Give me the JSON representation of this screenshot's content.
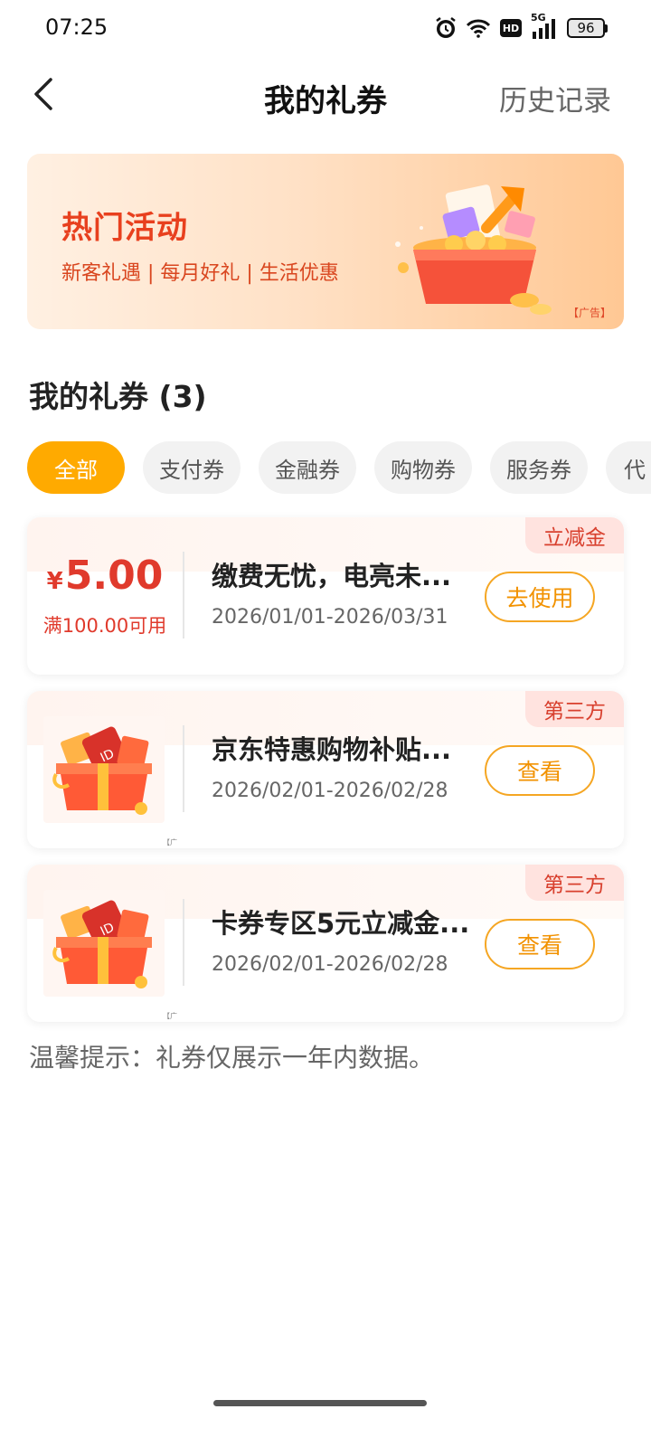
{
  "status_bar": {
    "time": "07:25",
    "network": "5G",
    "hd_label": "HD",
    "battery": "96"
  },
  "header": {
    "title": "我的礼券",
    "history": "历史记录"
  },
  "banner": {
    "title": "热门活动",
    "subtitle": "新客礼遇 | 每月好礼 | 生活优惠",
    "ad_label": "【广告】"
  },
  "section": {
    "title": "我的礼券 (3)"
  },
  "tabs": [
    {
      "label": "全部",
      "active": true
    },
    {
      "label": "支付券",
      "active": false
    },
    {
      "label": "金融券",
      "active": false
    },
    {
      "label": "购物券",
      "active": false
    },
    {
      "label": "服务券",
      "active": false
    },
    {
      "label": "代",
      "active": false
    }
  ],
  "coupons": [
    {
      "tag": "立减金",
      "currency": "¥",
      "amount": "5.00",
      "condition": "满100.00可用",
      "name": "缴费无忧，电亮未...",
      "date": "2026/01/01-2026/03/31",
      "button": "去使用"
    },
    {
      "tag": "第三方",
      "image_ad": "【广告】",
      "name": "京东特惠购物补贴...",
      "date": "2026/02/01-2026/02/28",
      "button": "查看"
    },
    {
      "tag": "第三方",
      "image_ad": "【广告】",
      "name": "卡券专区5元立减金...",
      "date": "2026/02/01-2026/02/28",
      "button": "查看"
    }
  ],
  "tip": "温馨提示：礼券仅展示一年内数据。",
  "colors": {
    "accent": "#ffaa00",
    "price_red": "#e03a2c",
    "button_orange": "#f29200"
  }
}
